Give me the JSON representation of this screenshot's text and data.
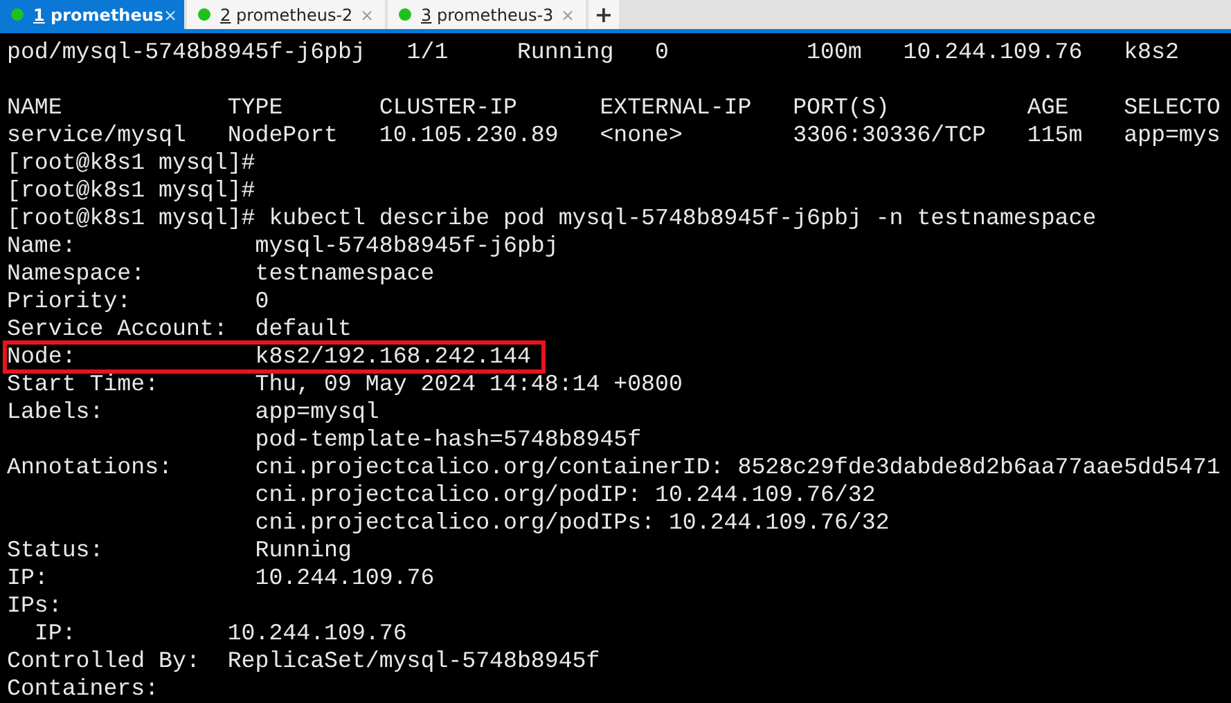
{
  "tabs": [
    {
      "number": "1",
      "title": "prometheus",
      "selected": true,
      "close": "×"
    },
    {
      "number": "2",
      "title": "prometheus-2",
      "selected": false,
      "close": "×"
    },
    {
      "number": "3",
      "title": "prometheus-3",
      "selected": false,
      "close": "×"
    }
  ],
  "new_tab": "+",
  "terminal": {
    "lines": [
      {
        "text": "pod/mysql-5748b8945f-j6pbj   1/1     Running   0          100m   10.244.109.76   k8s2",
        "highlighted": false
      },
      {
        "blank_line_before": true,
        "text": "NAME            TYPE       CLUSTER-IP      EXTERNAL-IP   PORT(S)          AGE    SELECTO",
        "highlighted": false
      },
      {
        "text": "service/mysql   NodePort   10.105.230.89   <none>        3306:30336/TCP   115m   app=mys",
        "highlighted": false
      },
      {
        "text": "[root@k8s1 mysql]#",
        "highlighted": false
      },
      {
        "text": "[root@k8s1 mysql]#",
        "highlighted": false
      },
      {
        "text": "[root@k8s1 mysql]# kubectl describe pod mysql-5748b8945f-j6pbj -n testnamespace",
        "highlighted": false
      },
      {
        "text": "Name:             mysql-5748b8945f-j6pbj",
        "highlighted": false
      },
      {
        "text": "Namespace:        testnamespace",
        "highlighted": false
      },
      {
        "text": "Priority:         0",
        "highlighted": false
      },
      {
        "text": "Service Account:  default",
        "highlighted": false
      },
      {
        "text": "Node:             k8s2/192.168.242.144",
        "highlighted": true
      },
      {
        "text": "Start Time:       Thu, 09 May 2024 14:48:14 +0800",
        "highlighted": false
      },
      {
        "text": "Labels:           app=mysql",
        "highlighted": false
      },
      {
        "text": "                  pod-template-hash=5748b8945f",
        "highlighted": false
      },
      {
        "text": "Annotations:      cni.projectcalico.org/containerID: 8528c29fde3dabde8d2b6aa77aae5dd5471",
        "highlighted": false
      },
      {
        "text": "                  cni.projectcalico.org/podIP: 10.244.109.76/32",
        "highlighted": false
      },
      {
        "text": "                  cni.projectcalico.org/podIPs: 10.244.109.76/32",
        "highlighted": false
      },
      {
        "text": "Status:           Running",
        "highlighted": false
      },
      {
        "text": "IP:               10.244.109.76",
        "highlighted": false
      },
      {
        "text": "IPs:",
        "highlighted": false
      },
      {
        "text": "  IP:           10.244.109.76",
        "highlighted": false
      },
      {
        "text": "Controlled By:  ReplicaSet/mysql-5748b8945f",
        "highlighted": false
      },
      {
        "text": "Containers:",
        "highlighted": false
      }
    ]
  }
}
